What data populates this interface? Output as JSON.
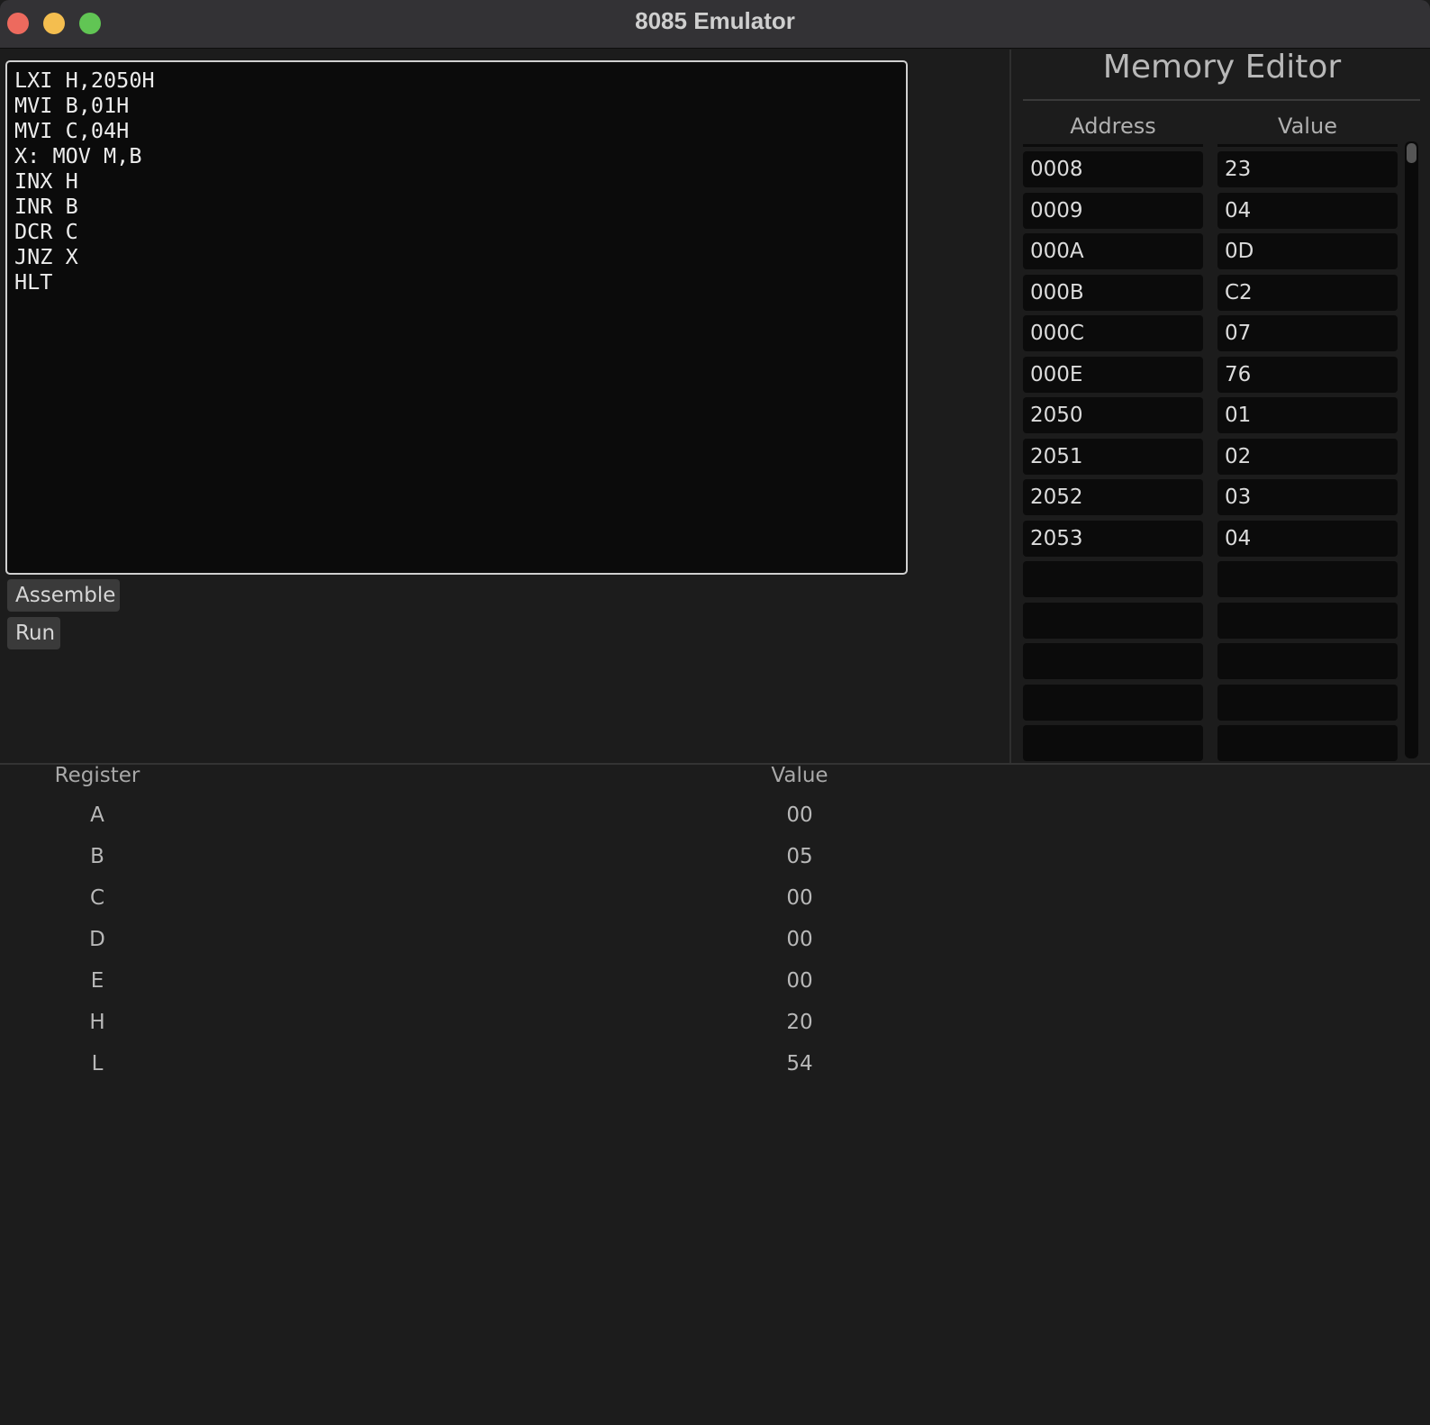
{
  "window": {
    "title": "8085 Emulator"
  },
  "editor": {
    "lines": [
      "LXI H,2050H",
      "MVI B,01H",
      "MVI C,04H",
      "X: MOV M,B",
      "INX H",
      "INR B",
      "DCR C",
      "JNZ X",
      "HLT"
    ]
  },
  "buttons": {
    "assemble": "Assemble",
    "run": "Run"
  },
  "memory_editor": {
    "title": "Memory Editor",
    "columns": [
      "Address",
      "Value"
    ],
    "rows": [
      {
        "address": "0008",
        "value": "23"
      },
      {
        "address": "0009",
        "value": "04"
      },
      {
        "address": "000A",
        "value": "0D"
      },
      {
        "address": "000B",
        "value": "C2"
      },
      {
        "address": "000C",
        "value": "07"
      },
      {
        "address": "000E",
        "value": "76"
      },
      {
        "address": "2050",
        "value": "01"
      },
      {
        "address": "2051",
        "value": "02"
      },
      {
        "address": "2052",
        "value": "03"
      },
      {
        "address": "2053",
        "value": "04"
      },
      {
        "address": "",
        "value": ""
      },
      {
        "address": "",
        "value": ""
      },
      {
        "address": "",
        "value": ""
      },
      {
        "address": "",
        "value": ""
      },
      {
        "address": "",
        "value": ""
      }
    ]
  },
  "registers": {
    "columns": [
      "Register",
      "Value"
    ],
    "rows": [
      {
        "name": "A",
        "value": "00"
      },
      {
        "name": "B",
        "value": "05"
      },
      {
        "name": "C",
        "value": "00"
      },
      {
        "name": "D",
        "value": "00"
      },
      {
        "name": "E",
        "value": "00"
      },
      {
        "name": "H",
        "value": "20"
      },
      {
        "name": "L",
        "value": "54"
      }
    ]
  },
  "colors": {
    "window_bg": "#1c1c1c",
    "titlebar_bg": "#333235",
    "editor_bg": "#0b0b0b",
    "close": "#ed6a5e",
    "minimize": "#f4be4f",
    "maximize": "#61c554"
  }
}
